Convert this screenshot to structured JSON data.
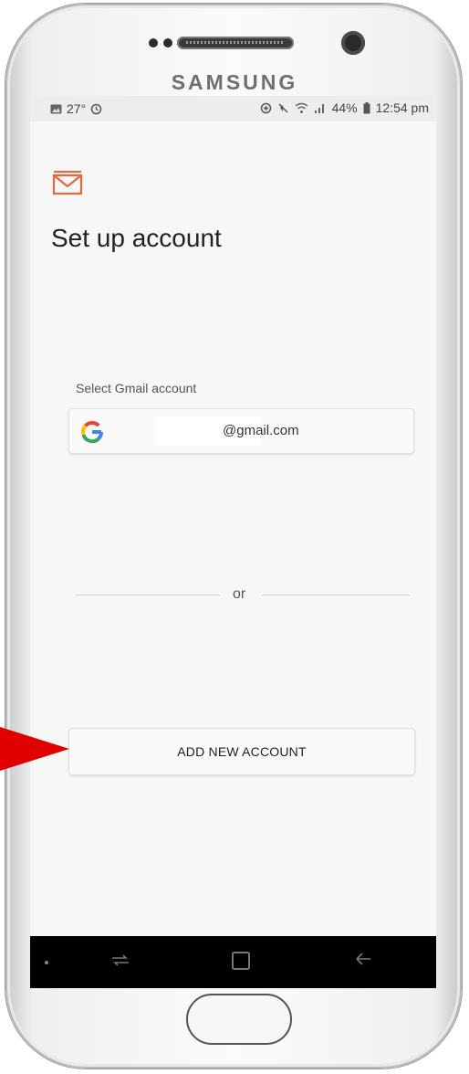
{
  "device": {
    "brand": "SAMSUNG"
  },
  "status_bar": {
    "temperature": "27°",
    "battery": "44%",
    "time": "12:54 pm",
    "icons_left": [
      "gallery-icon",
      "sync-icon"
    ],
    "icons_right": [
      "data-saver-icon",
      "mute-icon",
      "wifi-icon",
      "signal-icon",
      "battery-icon"
    ]
  },
  "header": {
    "title": "Set up account",
    "icon": "mail-icon",
    "accent_color": "#e8663d"
  },
  "gmail": {
    "label": "Select Gmail account",
    "account_suffix": "@gmail.com",
    "icon": "google-icon"
  },
  "divider": {
    "text": "or"
  },
  "actions": {
    "add_account_label": "ADD NEW ACCOUNT"
  },
  "navigation": {
    "buttons": [
      "recent-apps-icon",
      "home-icon",
      "back-icon"
    ]
  },
  "annotation": {
    "arrow_color": "#e10000"
  }
}
